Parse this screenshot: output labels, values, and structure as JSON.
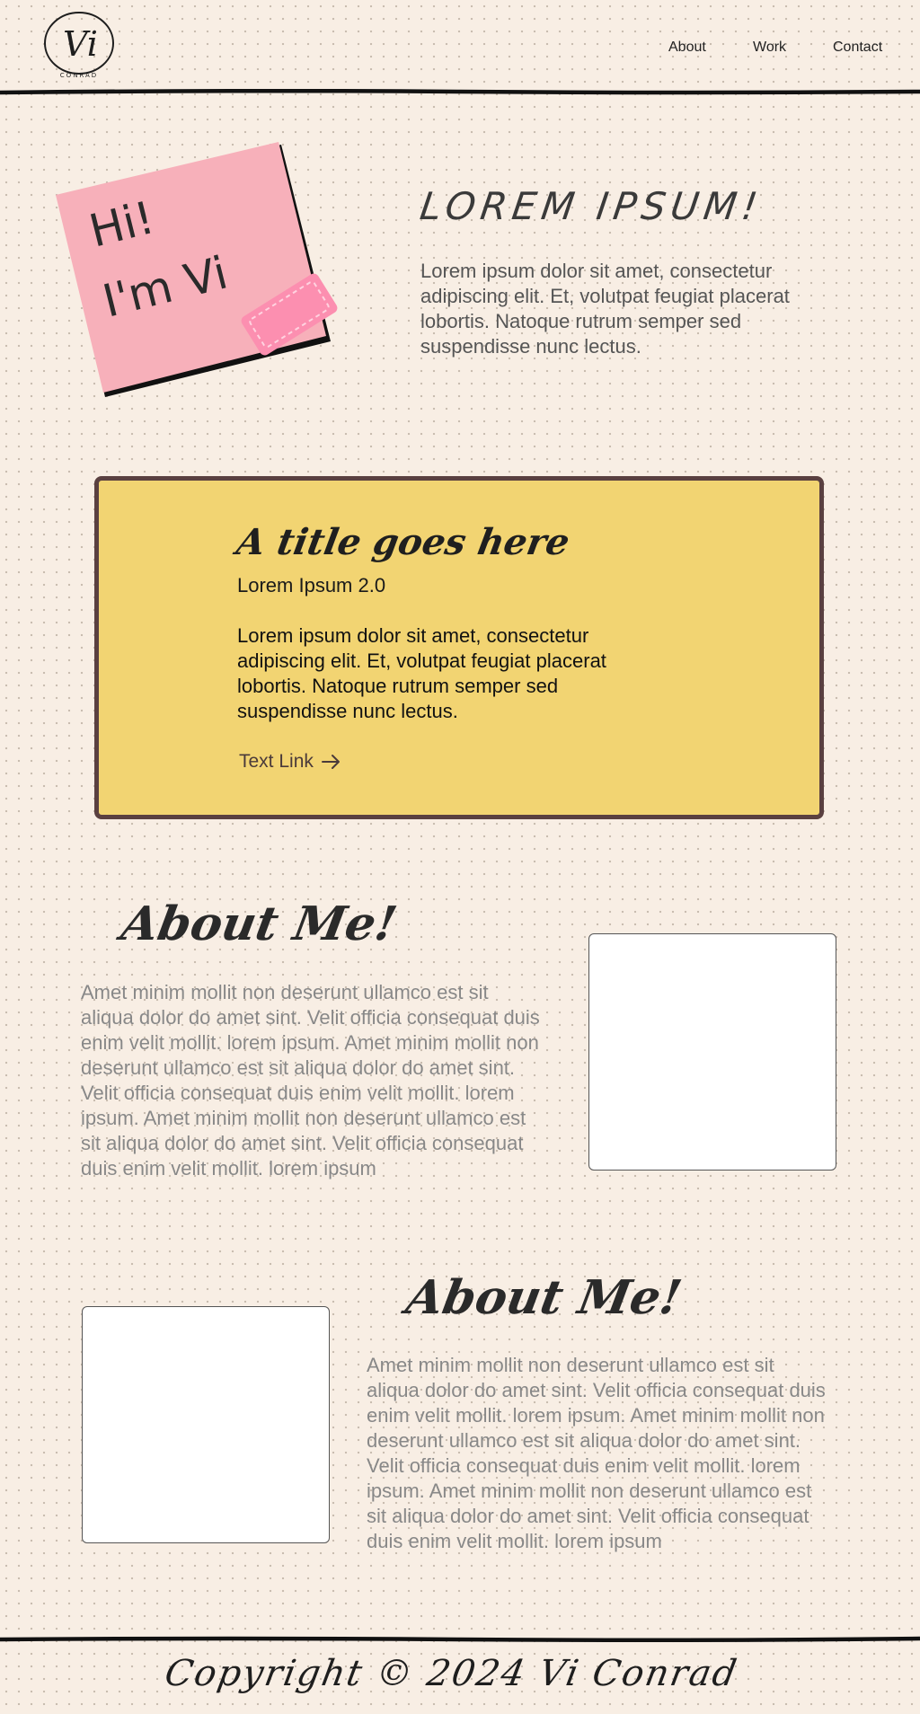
{
  "header": {
    "logo": {
      "monogram": "Vi",
      "wordmark": "CONRAD"
    },
    "nav": [
      {
        "label": "About"
      },
      {
        "label": "Work"
      },
      {
        "label": "Contact"
      }
    ]
  },
  "hero": {
    "sticky_note": {
      "line1": "Hi!",
      "line2": "I'm Vi",
      "note_color": "#f7b0ba",
      "tape_color": "#fc8fb0"
    },
    "title": "LOREM IPSUM!",
    "text": "Lorem ipsum dolor sit amet, consectetur adipiscing elit. Et, volutpat feugiat placerat lobortis. Natoque rutrum semper sed suspendisse nunc lectus."
  },
  "card": {
    "title": "A title goes here",
    "subtitle": "Lorem Ipsum 2.0",
    "body": "Lorem ipsum dolor sit amet, consectetur adipiscing elit. Et, volutpat feugiat placerat lobortis. Natoque rutrum semper sed suspendisse nunc lectus.",
    "link_label": "Text Link",
    "link_icon": "arrow-right-icon",
    "background": "#f2d472",
    "border": "#5a4040"
  },
  "about_sections": [
    {
      "title": "About Me!",
      "text": "Amet minim mollit non deserunt ullamco est sit aliqua dolor do amet sint. Velit officia consequat duis enim velit mollit. lorem ipsum. Amet minim mollit non deserunt ullamco est sit aliqua dolor do amet sint. Velit officia consequat duis enim velit mollit. lorem ipsum. Amet minim mollit non deserunt ullamco est sit aliqua dolor do amet sint. Velit officia consequat duis enim velit mollit. lorem ipsum"
    },
    {
      "title": "About Me!",
      "text": "Amet minim mollit non deserunt ullamco est sit aliqua dolor do amet sint. Velit officia consequat duis enim velit mollit. lorem ipsum. Amet minim mollit non deserunt ullamco est sit aliqua dolor do amet sint. Velit officia consequat duis enim velit mollit. lorem ipsum. Amet minim mollit non deserunt ullamco est sit aliqua dolor do amet sint. Velit officia consequat duis enim velit mollit. lorem ipsum"
    }
  ],
  "footer": {
    "copyright": "Copyright © 2024 Vi Conrad"
  },
  "colors": {
    "page_background": "#f8eee4",
    "text_dark": "#2b2b2b",
    "text_muted": "#888888"
  }
}
